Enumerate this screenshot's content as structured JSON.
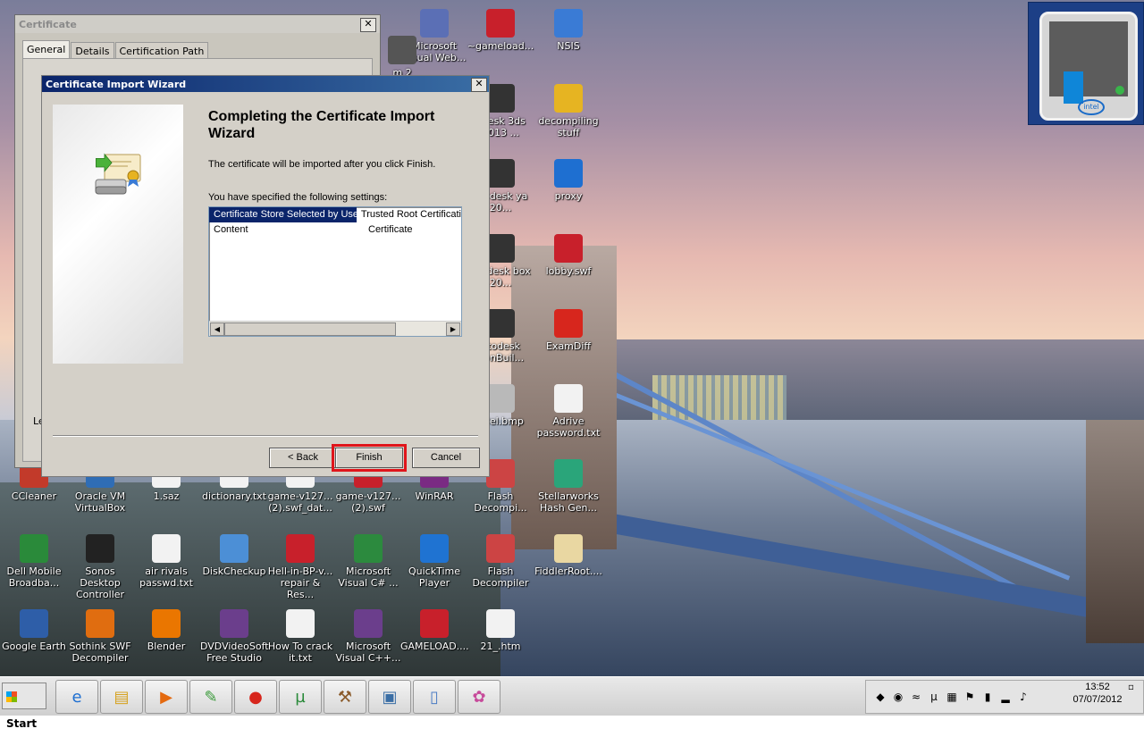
{
  "desktop_icons": [
    {
      "label": "Microsoft Visual Web...",
      "icon": "vs-web-icon",
      "color": "#5b6fb5"
    },
    {
      "label": "~gameload...",
      "icon": "flash-fla-icon",
      "color": "#c8202b"
    },
    {
      "label": "NSIS",
      "icon": "nsis-icon",
      "color": "#3a7bd5"
    },
    {
      "label": "m 2",
      "icon": "app-icon",
      "color": "#555"
    },
    {
      "label": "odesk 3ds 2013 ...",
      "icon": "autodesk-3ds-icon",
      "color": "#333"
    },
    {
      "label": "decompiling stuff",
      "icon": "folder-icon",
      "color": "#e6b422"
    },
    {
      "label": "utodesk ya 20...",
      "icon": "autodesk-maya-icon",
      "color": "#333"
    },
    {
      "label": "proxy",
      "icon": "ie-icon",
      "color": "#1e6fd1"
    },
    {
      "label": "utodesk box 20...",
      "icon": "autodesk-mudbox-icon",
      "color": "#333"
    },
    {
      "label": "lobby.swf",
      "icon": "swf-icon",
      "color": "#c8202b"
    },
    {
      "label": "utodesk tionBuil...",
      "icon": "autodesk-motionbuilder-icon",
      "color": "#333"
    },
    {
      "label": "ExamDiff",
      "icon": "examdiff-icon",
      "color": "#d7261d"
    },
    {
      "label": "odel.bmp",
      "icon": "bmp-icon",
      "color": "#b9b9b9"
    },
    {
      "label": "Adrive password.txt",
      "icon": "text-file-icon",
      "color": "#f2f2f2"
    },
    {
      "label": "CCleaner",
      "icon": "ccleaner-icon",
      "color": "#c23a2a"
    },
    {
      "label": "Oracle VM VirtualBox",
      "icon": "virtualbox-icon",
      "color": "#2f6db5"
    },
    {
      "label": "1.saz",
      "icon": "file-icon",
      "color": "#f2f2f2"
    },
    {
      "label": "dictionary.txt",
      "icon": "text-file-icon",
      "color": "#f2f2f2"
    },
    {
      "label": "game-v127... (2).swf_dat...",
      "icon": "file-icon",
      "color": "#f2f2f2"
    },
    {
      "label": "game-v127... (2).swf",
      "icon": "swf-icon",
      "color": "#c8202b"
    },
    {
      "label": "WinRAR",
      "icon": "winrar-icon",
      "color": "#7a2b83"
    },
    {
      "label": "Flash Decompi...",
      "icon": "flash-decompiler-icon",
      "color": "#c44"
    },
    {
      "label": "Stellarworks Hash Gen...",
      "icon": "hash-gen-icon",
      "color": "#2aa57a"
    },
    {
      "label": "Dell Mobile Broadba...",
      "icon": "dell-broadband-icon",
      "color": "#2a8a3a"
    },
    {
      "label": "Sonos Desktop Controller",
      "icon": "sonos-icon",
      "color": "#222"
    },
    {
      "label": "air rivals passwd.txt",
      "icon": "text-file-icon",
      "color": "#f2f2f2"
    },
    {
      "label": "DiskCheckup",
      "icon": "diskcheckup-icon",
      "color": "#4c8fd6"
    },
    {
      "label": "Hell-in-BP-v... repair & Res...",
      "icon": "swf-icon",
      "color": "#c8202b"
    },
    {
      "label": "Microsoft Visual C# ...",
      "icon": "vs-csharp-icon",
      "color": "#2c8a3e"
    },
    {
      "label": "QuickTime Player",
      "icon": "quicktime-icon",
      "color": "#1f73d2"
    },
    {
      "label": "Flash Decompiler",
      "icon": "flash-decompiler-icon",
      "color": "#c44"
    },
    {
      "label": "FiddlerRoot....",
      "icon": "certificate-icon",
      "color": "#e9d7a2"
    },
    {
      "label": "Google Earth",
      "icon": "google-earth-icon",
      "color": "#2e5ea8"
    },
    {
      "label": "Sothink SWF Decompiler",
      "icon": "sothink-icon",
      "color": "#e06d10"
    },
    {
      "label": "Blender",
      "icon": "blender-icon",
      "color": "#ea7600"
    },
    {
      "label": "DVDVideoSoft Free Studio",
      "icon": "dvdvideosoft-icon",
      "color": "#6b3e8c"
    },
    {
      "label": "How To crack it.txt",
      "icon": "text-file-icon",
      "color": "#f2f2f2"
    },
    {
      "label": "Microsoft Visual C++...",
      "icon": "vs-cpp-icon",
      "color": "#6b3e8c"
    },
    {
      "label": "GAMELOAD....",
      "icon": "as-file-icon",
      "color": "#c8202b"
    },
    {
      "label": "21_.htm",
      "icon": "html-file-icon",
      "color": "#f2f2f2"
    }
  ],
  "certificate_window": {
    "title": "Certificate",
    "tabs": [
      "General",
      "Details",
      "Certification Path"
    ],
    "partial_left_text": "Le"
  },
  "wizard": {
    "title": "Certificate Import Wizard",
    "heading": "Completing the Certificate Import Wizard",
    "description": "The certificate will be imported after you click Finish.",
    "settings_label": "You have specified the following settings:",
    "settings": [
      {
        "name": "Certificate Store Selected by User",
        "value": "Trusted Root Certificati"
      },
      {
        "name": "Content",
        "value": "Certificate"
      }
    ],
    "back_label": "< Back",
    "finish_label": "Finish",
    "cancel_label": "Cancel",
    "highlight_color": "#e0151b"
  },
  "taskbar": {
    "start_label": "Start",
    "apps": [
      "ie-icon",
      "explorer-icon",
      "media-player-icon",
      "notepad-icon",
      "examdiff-icon",
      "utorrent-icon",
      "tools-icon",
      "computer-icon",
      "document-icon",
      "paint-icon"
    ],
    "clock_time": "13:52",
    "clock_date": "07/07/2012"
  },
  "colors": {
    "wizard_title": "#0a246a",
    "selection": "#0a246a"
  }
}
